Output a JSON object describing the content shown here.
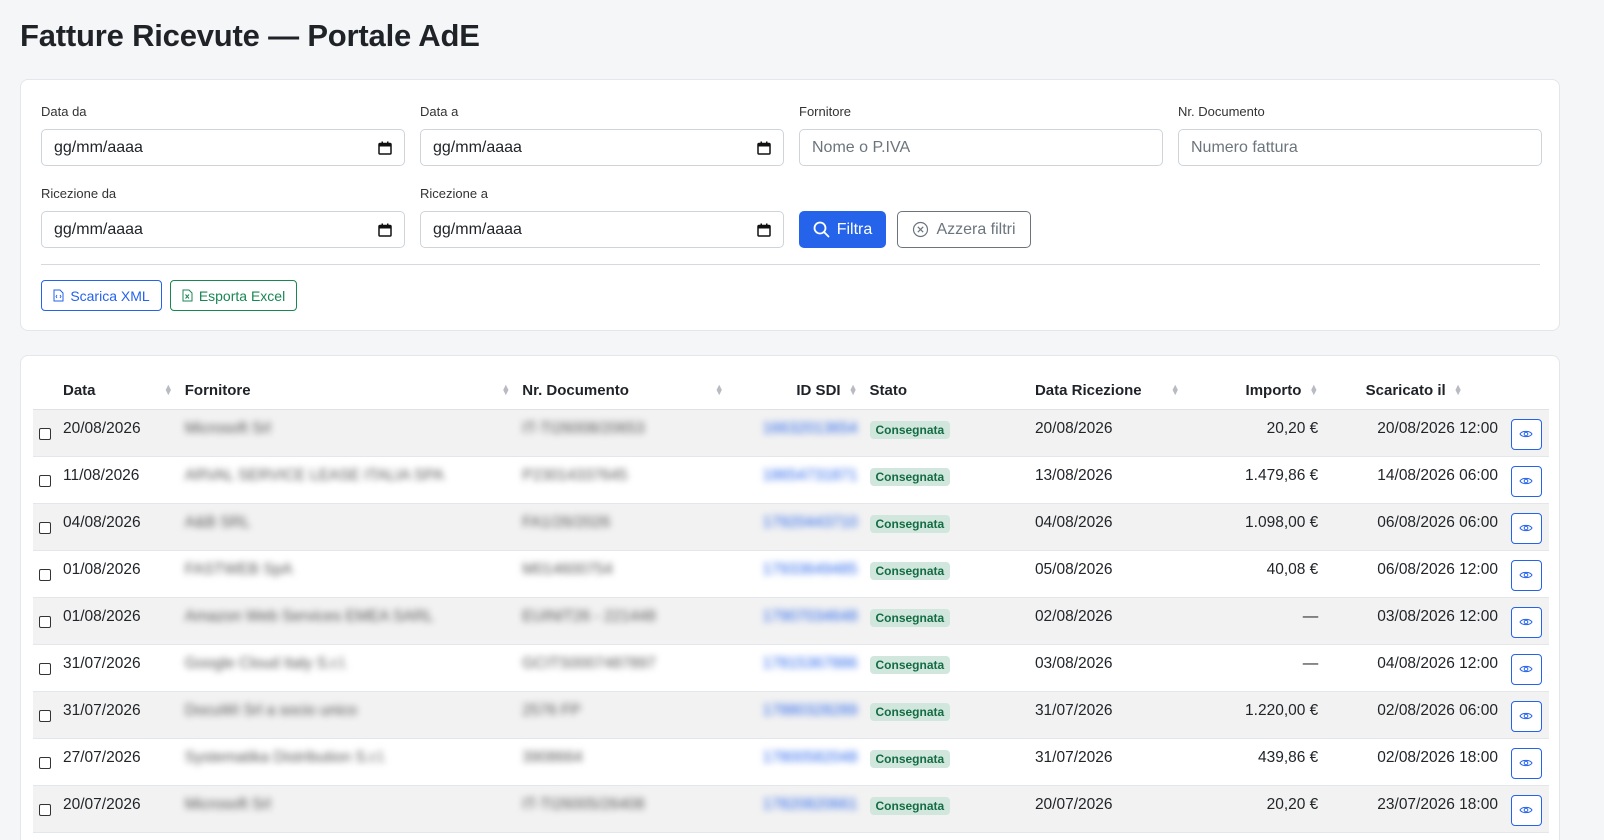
{
  "page": {
    "title": "Fatture Ricevute — Portale AdE"
  },
  "filters": {
    "data_da": {
      "label": "Data da",
      "value": "gg/mm/aaaa"
    },
    "data_a": {
      "label": "Data a",
      "value": "gg/mm/aaaa"
    },
    "fornitore": {
      "label": "Fornitore",
      "placeholder": "Nome o P.IVA"
    },
    "nr_documento": {
      "label": "Nr. Documento",
      "placeholder": "Numero fattura"
    },
    "ricezione_da": {
      "label": "Ricezione da",
      "value": "gg/mm/aaaa"
    },
    "ricezione_a": {
      "label": "Ricezione a",
      "value": "gg/mm/aaaa"
    },
    "filtra_label": "Filtra",
    "azzera_label": "Azzera filtri"
  },
  "actions": {
    "scarica_xml": "Scarica XML",
    "esporta_excel": "Esporta Excel"
  },
  "table": {
    "headers": {
      "data": "Data",
      "fornitore": "Fornitore",
      "nr_documento": "Nr. Documento",
      "id_sdi": "ID SDI",
      "stato": "Stato",
      "data_ricezione": "Data Ricezione",
      "importo": "Importo",
      "scaricato_il": "Scaricato il"
    },
    "rows": [
      {
        "data": "20/08/2026",
        "fornitore": "Microsoft Srl",
        "nr": "IT-TI26008/20653",
        "sdi": "16632013654",
        "stato": "Consegnata",
        "ricezione": "20/08/2026",
        "importo": "20,20 €",
        "scaricato": "20/08/2026 12:00"
      },
      {
        "data": "11/08/2026",
        "fornitore": "ARVAL SERVICE LEASE ITALIA SPA",
        "nr": "P23014337645",
        "sdi": "18654731871",
        "stato": "Consegnata",
        "ricezione": "13/08/2026",
        "importo": "1.479,86 €",
        "scaricato": "14/08/2026 06:00"
      },
      {
        "data": "04/08/2026",
        "fornitore": "A&B SRL",
        "nr": "FA1/26/2026",
        "sdi": "17920443710",
        "stato": "Consegnata",
        "ricezione": "04/08/2026",
        "importo": "1.098,00 €",
        "scaricato": "06/08/2026 06:00"
      },
      {
        "data": "01/08/2026",
        "fornitore": "FASTWEB SpA",
        "nr": "M014600754",
        "sdi": "17933649485",
        "stato": "Consegnata",
        "ricezione": "05/08/2026",
        "importo": "40,08 €",
        "scaricato": "06/08/2026 12:00"
      },
      {
        "data": "01/08/2026",
        "fornitore": "Amazon Web Services EMEA SARL",
        "nr": "EUINIT26 - 221448",
        "sdi": "17907034648",
        "stato": "Consegnata",
        "ricezione": "02/08/2026",
        "importo": "—",
        "scaricato": "03/08/2026 12:00"
      },
      {
        "data": "31/07/2026",
        "fornitore": "Google Cloud Italy S.r.l.",
        "nr": "GCITS0007487897",
        "sdi": "17815367886",
        "stato": "Consegnata",
        "ricezione": "03/08/2026",
        "importo": "—",
        "scaricato": "04/08/2026 12:00"
      },
      {
        "data": "31/07/2026",
        "fornitore": "DocuWi Srl a socio unico",
        "nr": "2576 FP",
        "sdi": "17880328289",
        "stato": "Consegnata",
        "ricezione": "31/07/2026",
        "importo": "1.220,00 €",
        "scaricato": "02/08/2026 06:00"
      },
      {
        "data": "27/07/2026",
        "fornitore": "Systematika Distribution S.r.l.",
        "nr": "3908664",
        "sdi": "17800582048",
        "stato": "Consegnata",
        "ricezione": "31/07/2026",
        "importo": "439,86 €",
        "scaricato": "02/08/2026 18:00"
      },
      {
        "data": "20/07/2026",
        "fornitore": "Microsoft Srl",
        "nr": "IT-TI26005/26408",
        "sdi": "17820820661",
        "stato": "Consegnata",
        "ricezione": "20/07/2026",
        "importo": "20,20 €",
        "scaricato": "23/07/2026 18:00"
      }
    ]
  },
  "colors": {
    "primary": "#2563eb",
    "success": "#198754",
    "badge_bg": "#d1e7dd"
  }
}
